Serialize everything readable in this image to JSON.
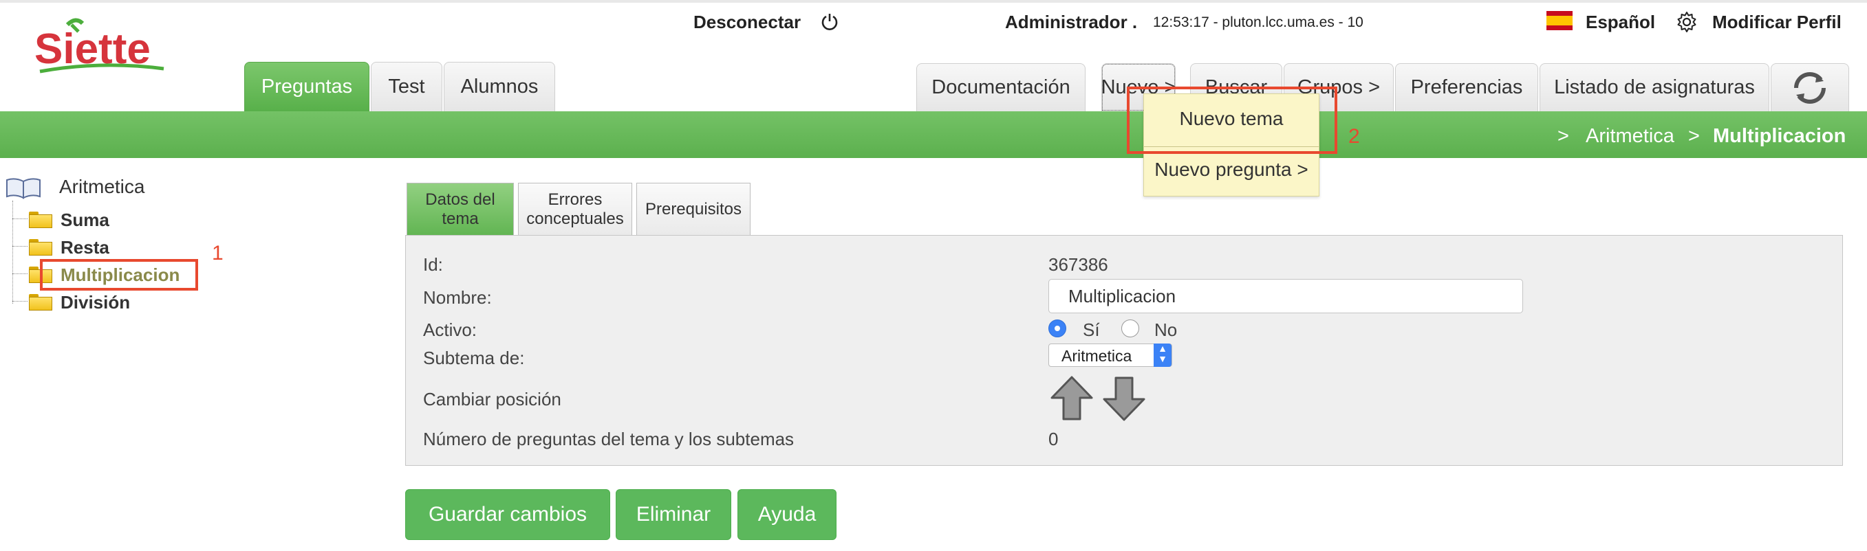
{
  "topbar": {
    "logout_label": "Desconectar",
    "user": "Administrador .",
    "session_info": "12:53:17 - pluton.lcc.uma.es - 10",
    "language": "Español",
    "profile_label": "Modificar Perfil"
  },
  "logo": {
    "text": "Siette"
  },
  "main_tabs": [
    "Preguntas",
    "Test",
    "Alumnos"
  ],
  "right_tabs": [
    "Documentación",
    "Nuevo >",
    "Buscar",
    "Grupos >",
    "Preferencias",
    "Listado de asignaturas"
  ],
  "breadcrumb": {
    "sep": ">",
    "items": [
      "Aritmetica",
      "Multiplicacion"
    ]
  },
  "dropdown": {
    "items": [
      "Nuevo tema",
      "Nuevo pregunta >"
    ]
  },
  "annotations": {
    "label1": "1",
    "label2": "2"
  },
  "tree": {
    "root": "Aritmetica",
    "children": [
      "Suma",
      "Resta",
      "Multiplicacion",
      "División"
    ],
    "selected": "Multiplicacion"
  },
  "subtabs": [
    "Datos del tema",
    "Errores conceptuales",
    "Prerequisitos"
  ],
  "form": {
    "id_label": "Id:",
    "id_value": "367386",
    "name_label": "Nombre:",
    "name_value": "Multiplicacion",
    "active_label": "Activo:",
    "active_yes": "Sí",
    "active_no": "No",
    "active_selected": "Sí",
    "subtheme_label": "Subtema de:",
    "subtheme_value": "Aritmetica",
    "position_label": "Cambiar posición",
    "count_label": "Número de preguntas del tema y los subtemas",
    "count_value": "0"
  },
  "buttons": {
    "save": "Guardar cambios",
    "delete": "Eliminar",
    "help": "Ayuda"
  },
  "colors": {
    "green": "#5cb85c",
    "annotation_red": "#e8492f",
    "dropdown_bg": "#fbf6c8",
    "tree_selected": "#8a8a4a"
  }
}
